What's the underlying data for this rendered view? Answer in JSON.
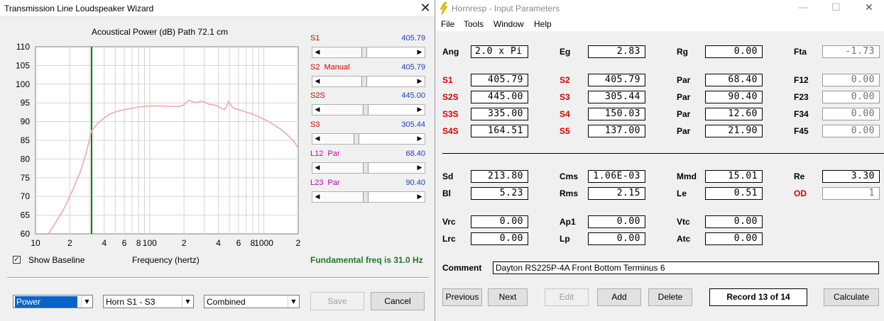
{
  "wizard": {
    "title": "Transmission Line Loudspeaker Wizard",
    "close_glyph": "✕",
    "chart_title": "Acoustical Power (dB)   Path 72.1 cm",
    "sliders": [
      {
        "label": "S1",
        "label2": "",
        "value": "405.79",
        "color": "#d40000",
        "fill": 0.42
      },
      {
        "label": "S2",
        "label2": "Manual",
        "value": "405.79",
        "color": "#d40000",
        "fill": 0.42
      },
      {
        "label": "S2S",
        "label2": "",
        "value": "445.00",
        "color": "#d40000",
        "fill": 0.44
      },
      {
        "label": "S3",
        "label2": "",
        "value": "305.44",
        "color": "#d40000",
        "fill": 0.34
      },
      {
        "label": "L12",
        "label2": "Par",
        "value": "68.40",
        "color": "#c000c0",
        "fill": 0.44
      },
      {
        "label": "L23",
        "label2": "Par",
        "value": "90.40",
        "color": "#c000c0",
        "fill": 0.44
      }
    ],
    "show_baseline": {
      "label": "Show Baseline",
      "checked": true,
      "check_glyph": "✓"
    },
    "xlabel": "Frequency (hertz)",
    "fundamental": "Fundamental freq is 31.0 Hz",
    "combos": [
      {
        "value": "Power",
        "selected": true
      },
      {
        "value": "Horn S1 - S3",
        "selected": false
      },
      {
        "value": "Combined",
        "selected": false
      }
    ],
    "dropdown_glyph": "▼",
    "save_label": "Save",
    "cancel_label": "Cancel"
  },
  "chart_data": {
    "type": "line",
    "title": "Acoustical Power (dB)   Path 72.1 cm",
    "xlabel": "Frequency (hertz)",
    "ylabel": "",
    "x_scale": "log",
    "xlim": [
      10,
      2000
    ],
    "ylim": [
      60,
      110
    ],
    "y_ticks": [
      "110",
      "105",
      "100",
      "95",
      "90",
      "85",
      "80",
      "75",
      "70",
      "65",
      "60"
    ],
    "x_ticks": [
      {
        "label": "10",
        "v": 10
      },
      {
        "label": "2",
        "v": 20
      },
      {
        "label": "4",
        "v": 40
      },
      {
        "label": "6",
        "v": 60
      },
      {
        "label": "8",
        "v": 80
      },
      {
        "label": "100",
        "v": 100
      },
      {
        "label": "2",
        "v": 200
      },
      {
        "label": "4",
        "v": 400
      },
      {
        "label": "6",
        "v": 600
      },
      {
        "label": "8",
        "v": 800
      },
      {
        "label": "1000",
        "v": 1000
      },
      {
        "label": "2",
        "v": 2000
      }
    ],
    "grid": true,
    "marker_freq": 31.0,
    "series": [
      {
        "color": "#f4a8a8",
        "x": [
          13,
          15,
          18,
          21,
          25,
          28,
          31,
          35,
          40,
          45,
          50,
          60,
          70,
          80,
          100,
          120,
          140,
          160,
          175,
          185,
          200,
          220,
          250,
          280,
          300,
          330,
          360,
          390,
          420,
          450,
          470,
          490,
          500,
          520,
          550,
          600,
          650,
          700,
          800,
          900,
          1000,
          1100,
          1200,
          1400,
          1600,
          1800,
          2000
        ],
        "y": [
          60,
          63,
          67,
          71.5,
          77,
          82,
          87.5,
          89.5,
          91,
          92,
          92.6,
          93.2,
          93.6,
          93.9,
          94.2,
          94.2,
          94.1,
          94.1,
          94,
          94.1,
          94.5,
          95.7,
          95.1,
          95.4,
          95.3,
          94.6,
          94.5,
          94.2,
          93.6,
          93.2,
          93.9,
          95.4,
          95.1,
          94.2,
          93.5,
          93.2,
          92.9,
          92.5,
          92,
          91.3,
          90.6,
          90,
          89.3,
          88,
          86.5,
          85,
          83
        ]
      }
    ]
  },
  "hornresp": {
    "title": "Hornresp - Input Parameters",
    "window_controls": [
      "—",
      "☐",
      "✕"
    ],
    "menu": [
      "File",
      "Tools",
      "Window",
      "Help"
    ],
    "params": [
      {
        "label": "Ang",
        "value": "2.0 x Pi",
        "red": false,
        "align": "left",
        "ro": false
      },
      {
        "label": "Eg",
        "value": "2.83",
        "red": false,
        "ro": false
      },
      {
        "label": "Rg",
        "value": "0.00",
        "red": false,
        "ro": false
      },
      {
        "label": "Fta",
        "value": "-1.73",
        "red": false,
        "ro": true
      },
      {
        "label": "S1",
        "value": "405.79",
        "red": true,
        "ro": false
      },
      {
        "label": "S2",
        "value": "405.79",
        "red": true,
        "ro": false
      },
      {
        "label": "Par",
        "value": "68.40",
        "red": false,
        "ro": false
      },
      {
        "label": "F12",
        "value": "0.00",
        "red": false,
        "ro": true
      },
      {
        "label": "S2S",
        "value": "445.00",
        "red": true,
        "ro": false
      },
      {
        "label": "S3",
        "value": "305.44",
        "red": true,
        "ro": false
      },
      {
        "label": "Par",
        "value": "90.40",
        "red": false,
        "ro": false
      },
      {
        "label": "F23",
        "value": "0.00",
        "red": false,
        "ro": true
      },
      {
        "label": "S3S",
        "value": "335.00",
        "red": true,
        "ro": false
      },
      {
        "label": "S4",
        "value": "150.03",
        "red": true,
        "ro": false
      },
      {
        "label": "Par",
        "value": "12.60",
        "red": false,
        "ro": false
      },
      {
        "label": "F34",
        "value": "0.00",
        "red": false,
        "ro": true
      },
      {
        "label": "S4S",
        "value": "164.51",
        "red": true,
        "ro": false
      },
      {
        "label": "S5",
        "value": "137.00",
        "red": true,
        "ro": false
      },
      {
        "label": "Par",
        "value": "21.90",
        "red": false,
        "ro": false
      },
      {
        "label": "F45",
        "value": "0.00",
        "red": false,
        "ro": true
      },
      {
        "label": "Sd",
        "value": "213.80",
        "red": false,
        "ro": false
      },
      {
        "label": "Cms",
        "value": "1.06E-03",
        "red": false,
        "ro": false
      },
      {
        "label": "Mmd",
        "value": "15.01",
        "red": false,
        "ro": false
      },
      {
        "label": "Re",
        "value": "3.30",
        "red": false,
        "ro": false
      },
      {
        "label": "Bl",
        "value": "5.23",
        "red": false,
        "ro": false
      },
      {
        "label": "Rms",
        "value": "2.15",
        "red": false,
        "ro": false
      },
      {
        "label": "Le",
        "value": "0.51",
        "red": false,
        "ro": false
      },
      {
        "label": "OD",
        "value": "1",
        "red": true,
        "ro": true
      },
      {
        "label": "Vrc",
        "value": "0.00",
        "red": false,
        "ro": false
      },
      {
        "label": "Ap1",
        "value": "0.00",
        "red": false,
        "ro": false
      },
      {
        "label": "Vtc",
        "value": "0.00",
        "red": false,
        "ro": false
      },
      {
        "label": "Lrc",
        "value": "0.00",
        "red": false,
        "ro": false
      },
      {
        "label": "Lp",
        "value": "0.00",
        "red": false,
        "ro": false
      },
      {
        "label": "Atc",
        "value": "0.00",
        "red": false,
        "ro": false
      }
    ],
    "comment_label": "Comment",
    "comment_value": "Dayton RS225P-4A Front Bottom Terminus 6",
    "buttons": {
      "previous": "Previous",
      "next": "Next",
      "edit": "Edit",
      "add": "Add",
      "delete": "Delete",
      "record": "Record 13 of 14",
      "calculate": "Calculate"
    }
  }
}
